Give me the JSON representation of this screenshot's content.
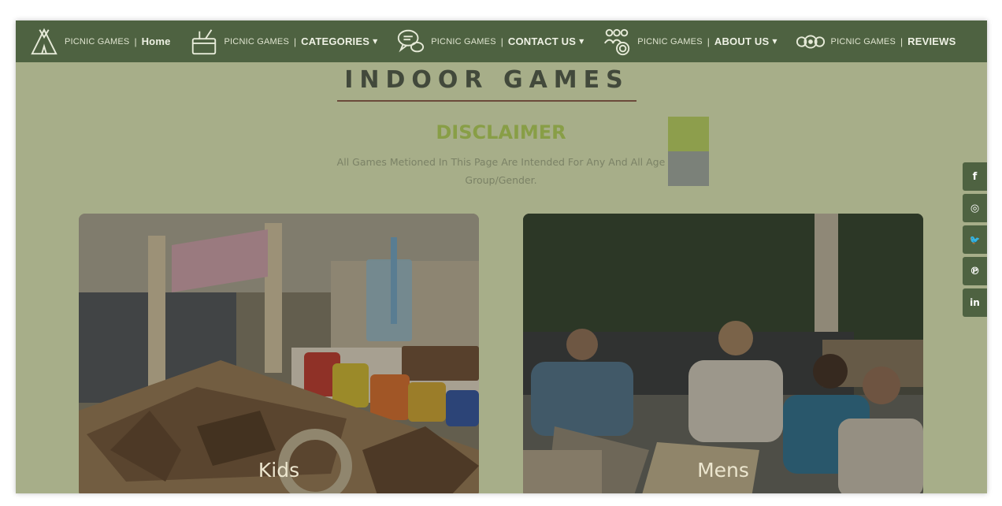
{
  "navbar": {
    "brand_text": "PICNIC GAMES",
    "separator": "|",
    "items": [
      {
        "label": "Home",
        "icon": "tent-icon",
        "dropdown": false
      },
      {
        "label": "CATEGORIES",
        "icon": "basket-icon",
        "dropdown": true
      },
      {
        "label": "CONTACT US",
        "icon": "chat-bubbles-icon",
        "dropdown": true
      },
      {
        "label": "ABOUT US",
        "icon": "people-icon",
        "dropdown": true
      },
      {
        "label": "REVIEWS",
        "icon": "review-icon",
        "dropdown": false
      }
    ],
    "caret_glyph": "▼"
  },
  "page": {
    "title": "INDOOR GAMES",
    "disclaimer_title": "DISCLAIMER",
    "disclaimer_text": "All Games Metioned In This Page Are Intended For Any And All Age Group/Gender."
  },
  "social": [
    {
      "icon": "facebook-icon",
      "glyph": "f"
    },
    {
      "icon": "instagram-icon",
      "glyph": "◎"
    },
    {
      "icon": "twitter-icon",
      "glyph": "🐦"
    },
    {
      "icon": "pinterest-icon",
      "glyph": "℗"
    },
    {
      "icon": "linkedin-icon",
      "glyph": "in"
    }
  ],
  "cards": [
    {
      "label": "Kids"
    },
    {
      "label": "Mens"
    }
  ],
  "colors": {
    "navbar": "#4e6241",
    "page_background": "#a7ae89",
    "disclaimer_title": "#889e46",
    "title_underline": "#6b4a3a"
  }
}
